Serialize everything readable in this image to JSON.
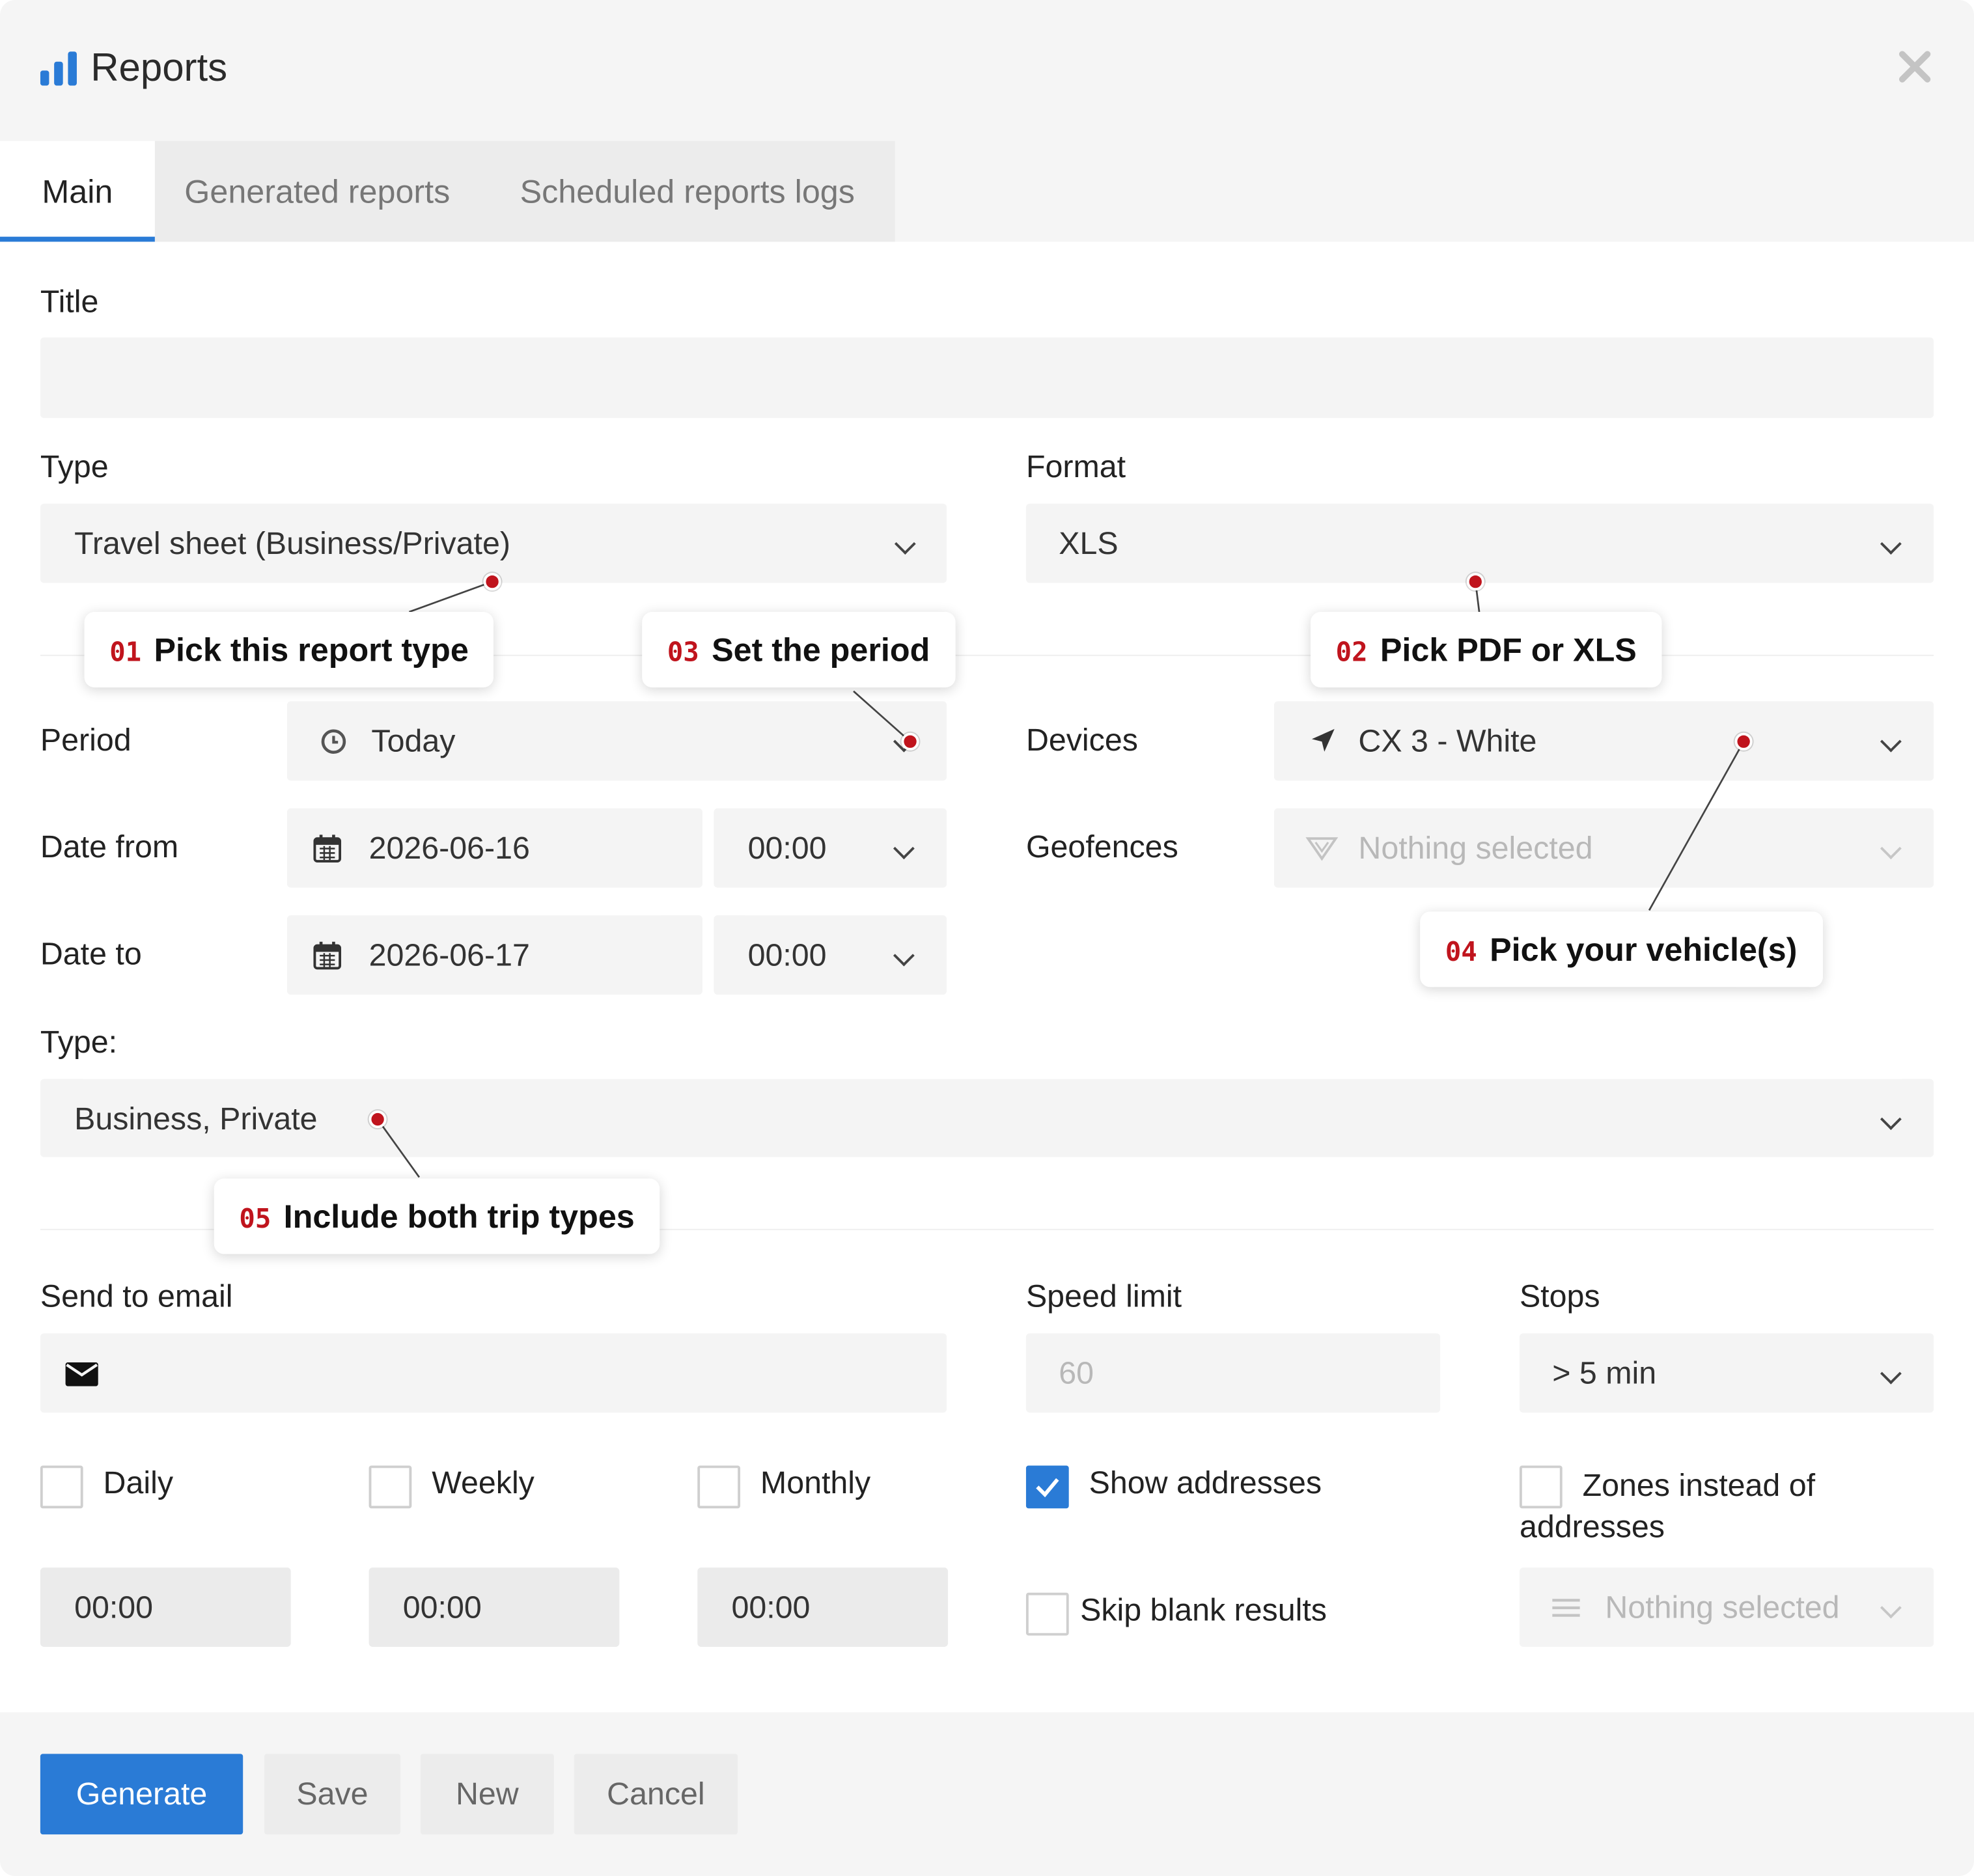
{
  "window": {
    "title": "Reports",
    "title_icon": "bar-chart-icon",
    "close_icon": "close-icon"
  },
  "tabs": [
    {
      "label": "Main",
      "active": true
    },
    {
      "label": "Generated reports",
      "active": false
    },
    {
      "label": "Scheduled reports logs",
      "active": false
    }
  ],
  "form": {
    "title_label": "Title",
    "title_value": "",
    "type_label": "Type",
    "type_value": "Travel sheet (Business/Private)",
    "format_label": "Format",
    "format_value": "XLS",
    "period_label": "Period",
    "period_value": "Today",
    "devices_label": "Devices",
    "devices_value": "CX 3 - White",
    "date_from_label": "Date from",
    "date_from_value": "2026-06-16",
    "date_from_time": "00:00",
    "geofences_label": "Geofences",
    "geofences_placeholder": "Nothing selected",
    "date_to_label": "Date to",
    "date_to_value": "2026-06-17",
    "date_to_time": "00:00",
    "trip_type_label": "Type:",
    "trip_type_value": "Business, Private",
    "send_email_label": "Send to email",
    "send_email_value": "",
    "speed_limit_label": "Speed limit",
    "speed_limit_placeholder": "60",
    "stops_label": "Stops",
    "stops_value": "> 5 min",
    "schedule": [
      {
        "label": "Daily",
        "checked": false,
        "time": "00:00"
      },
      {
        "label": "Weekly",
        "checked": false,
        "time": "00:00"
      },
      {
        "label": "Monthly",
        "checked": false,
        "time": "00:00"
      }
    ],
    "show_addresses_label": "Show addresses",
    "show_addresses_checked": true,
    "zones_label": "Zones instead of addresses",
    "zones_checked": false,
    "skip_blank_label": "Skip blank results",
    "skip_blank_checked": false,
    "zones_select_placeholder": "Nothing selected"
  },
  "footer": {
    "generate_label": "Generate",
    "save_label": "Save",
    "new_label": "New",
    "cancel_label": "Cancel"
  },
  "callouts": [
    {
      "num": "01",
      "text": "Pick this report type"
    },
    {
      "num": "02",
      "text": "Pick PDF or XLS"
    },
    {
      "num": "03",
      "text": "Set the period"
    },
    {
      "num": "04",
      "text": "Pick your vehicle(s)"
    },
    {
      "num": "05",
      "text": "Include both trip types"
    }
  ],
  "colors": {
    "accent": "#2a7bd6",
    "callout_number": "#c0141d",
    "field_bg": "#f4f4f4",
    "header_bg": "#f5f5f5"
  }
}
